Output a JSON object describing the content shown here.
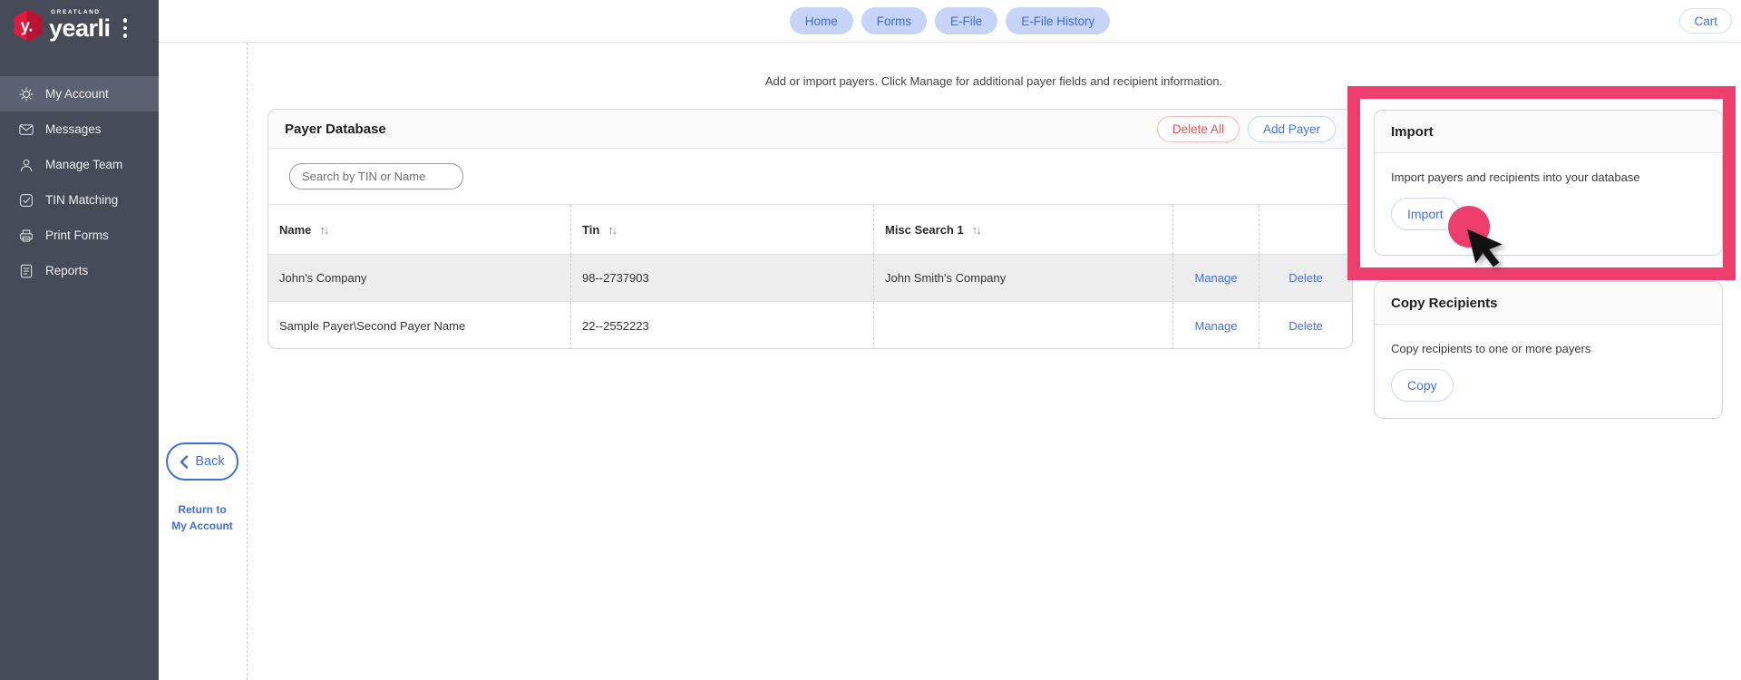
{
  "brand": {
    "greatland": "GREATLAND",
    "name": "yearli",
    "logo_mark": "y."
  },
  "topnav": {
    "items": [
      {
        "label": "Home"
      },
      {
        "label": "Forms"
      },
      {
        "label": "E-File"
      },
      {
        "label": "E-File History"
      }
    ],
    "cart_label": "Cart"
  },
  "sidebar": {
    "items": [
      {
        "label": "My Account",
        "icon": "gear-icon",
        "active": true
      },
      {
        "label": "Messages",
        "icon": "envelope-icon",
        "active": false
      },
      {
        "label": "Manage Team",
        "icon": "person-icon",
        "active": false
      },
      {
        "label": "TIN Matching",
        "icon": "check-square-icon",
        "active": false
      },
      {
        "label": "Print Forms",
        "icon": "printer-icon",
        "active": false
      },
      {
        "label": "Reports",
        "icon": "report-icon",
        "active": false
      }
    ]
  },
  "page": {
    "instruction": "Add or import payers. Click Manage for additional payer fields and recipient information."
  },
  "payer_panel": {
    "title": "Payer Database",
    "delete_all_label": "Delete All",
    "add_payer_label": "Add Payer",
    "search_placeholder": "Search by TIN or Name",
    "table": {
      "sort_icon": "↑↓",
      "columns": [
        "Name",
        "Tin",
        "Misc Search 1"
      ],
      "rows": [
        {
          "name": "John's Company",
          "tin": "98--2737903",
          "misc": "John Smith's Company",
          "manage_label": "Manage",
          "delete_label": "Delete"
        },
        {
          "name": "Sample Payer\\Second Payer Name",
          "tin": "22--2552223",
          "misc": "",
          "manage_label": "Manage",
          "delete_label": "Delete"
        }
      ]
    }
  },
  "import_panel": {
    "title": "Import",
    "description": "Import payers and recipients into your database",
    "button_label": "Import"
  },
  "copy_panel": {
    "title": "Copy Recipients",
    "description": "Copy recipients to one or more payers",
    "button_label": "Copy"
  },
  "back": {
    "label": "Back",
    "return_line1": "Return to",
    "return_line2": "My Account"
  },
  "colors": {
    "accent_pink": "#EE3E6D",
    "link_blue": "#4273E8",
    "danger_red": "#E05555",
    "sidebar_bg": "#454B57",
    "pill_bg": "#C5D4F7"
  }
}
